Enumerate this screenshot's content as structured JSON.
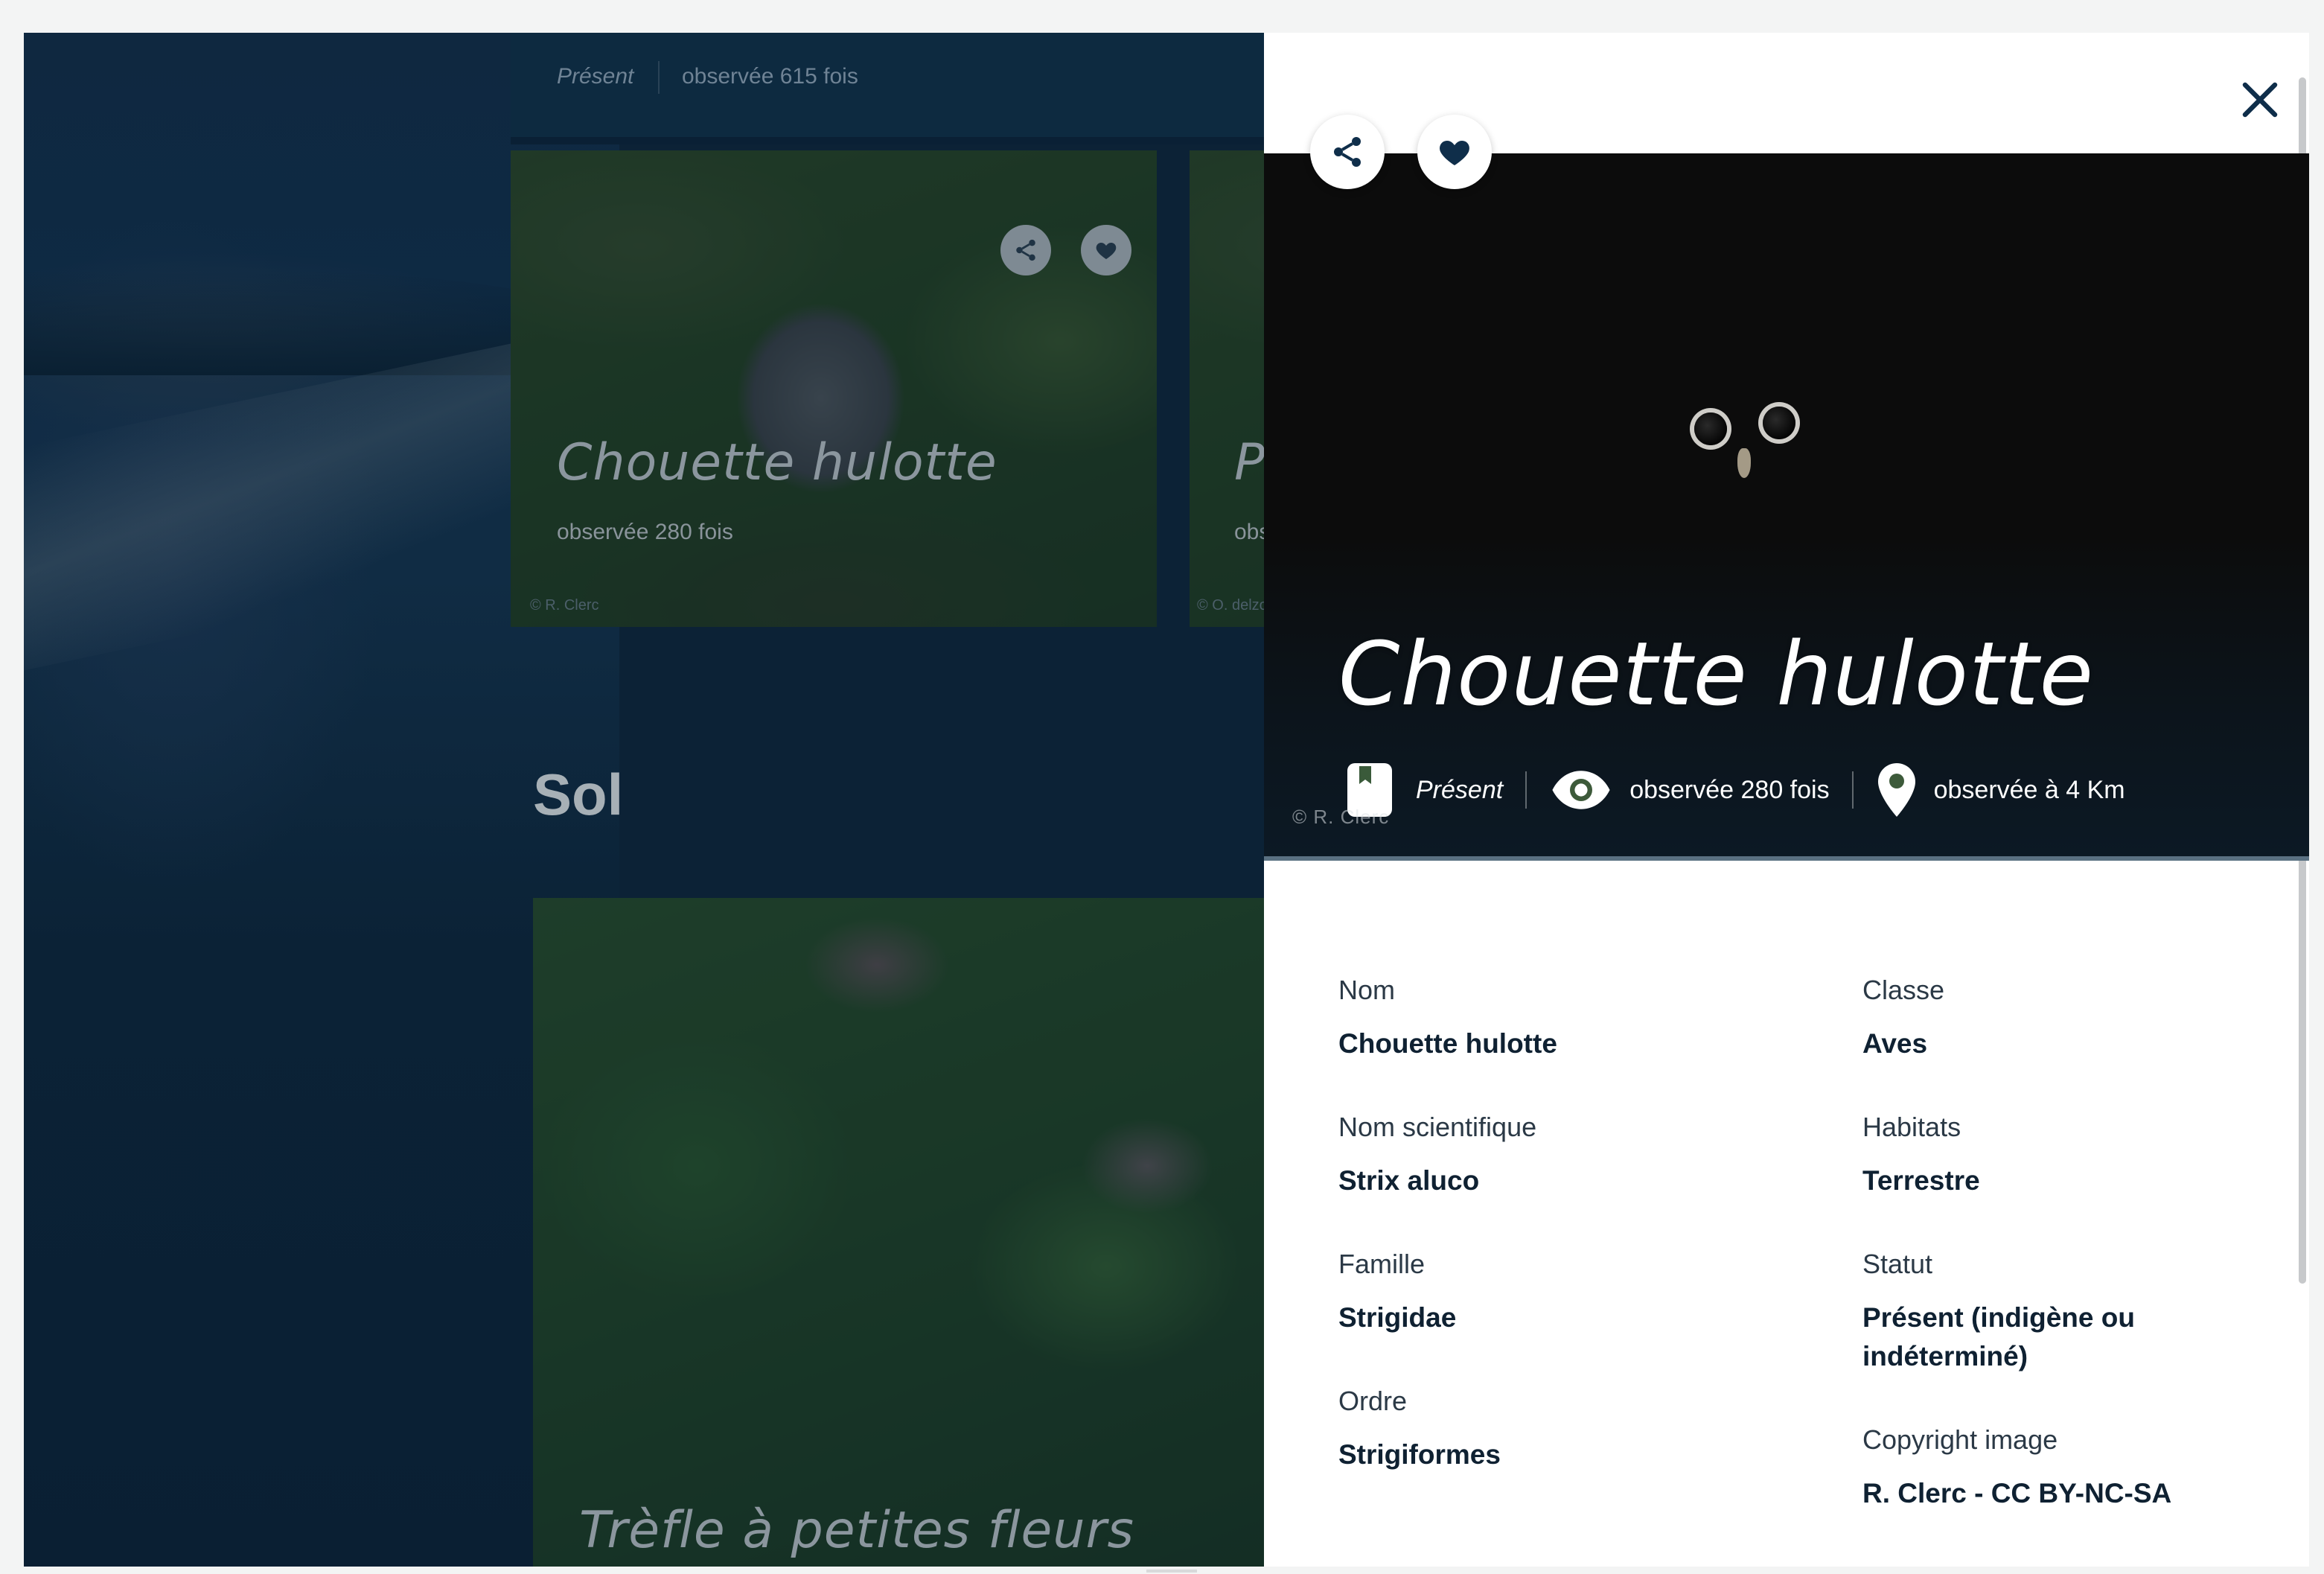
{
  "background": {
    "top_card": {
      "status": "Présent",
      "observed": "observée 615 fois"
    },
    "cards": [
      {
        "title": "Chouette hulotte",
        "observed": "observée 280 fois",
        "copyright": "© R. Clerc",
        "share_icon": "share-icon",
        "favorite_icon": "heart-icon"
      },
      {
        "title": "Pe",
        "observed": "obse",
        "copyright": "© O. delzon"
      }
    ],
    "section_title": "Sol",
    "section_card": {
      "title": "Trèfle à petites fleurs"
    }
  },
  "panel": {
    "close_icon": "close-icon",
    "share_icon": "share-icon",
    "favorite_icon": "heart-icon",
    "title": "Chouette hulotte",
    "status": "Présent",
    "observed": "observée 280 fois",
    "distance": "observée à 4 Km",
    "copyright": "© R. Clerc",
    "details": {
      "left": [
        {
          "label": "Nom",
          "value": "Chouette hulotte"
        },
        {
          "label": "Nom scientifique",
          "value": "Strix aluco"
        },
        {
          "label": "Famille",
          "value": "Strigidae"
        },
        {
          "label": "Ordre",
          "value": "Strigiformes"
        }
      ],
      "right": [
        {
          "label": "Classe",
          "value": "Aves"
        },
        {
          "label": "Habitats",
          "value": "Terrestre"
        },
        {
          "label": "Statut",
          "value": "Présent (indigène ou indéterminé)"
        },
        {
          "label": "Copyright image",
          "value": "R. Clerc - CC BY-NC-SA"
        }
      ]
    }
  },
  "colors": {
    "overlay": "#0c2236",
    "brand_dark": "#0f2e4a",
    "text_dark": "#0f2132"
  }
}
